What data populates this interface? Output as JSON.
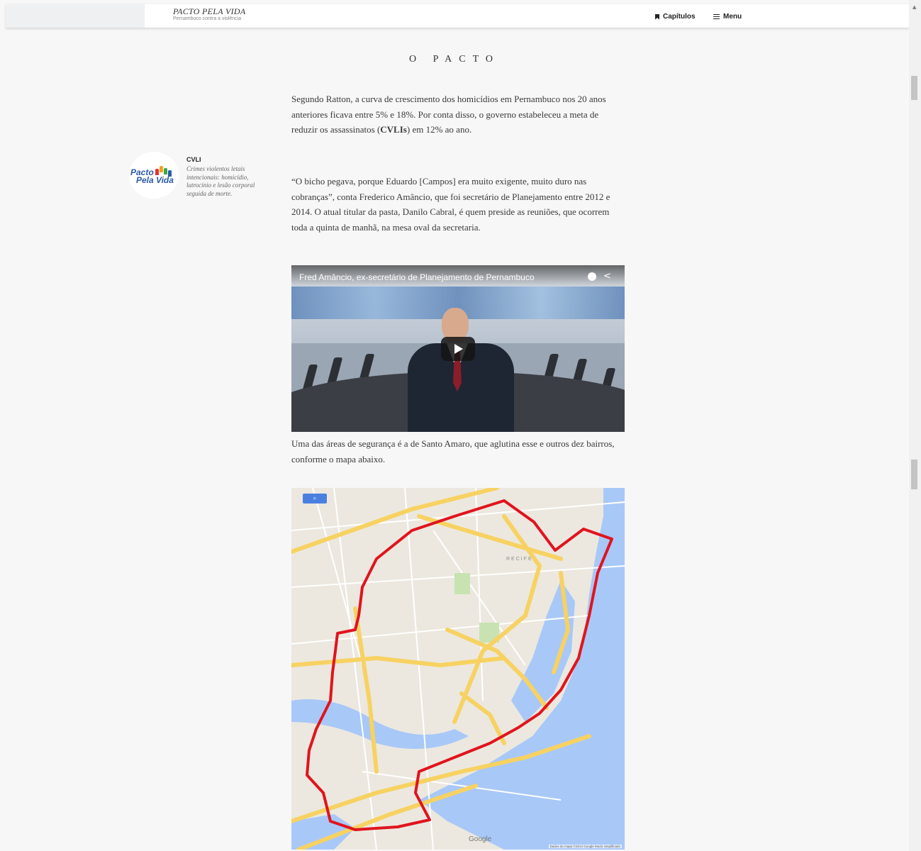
{
  "header": {
    "brand_title": "PACTO PELA VIDA",
    "brand_subtitle": "Pernambuco contra a violência",
    "nav_chapters": "Capítulos",
    "nav_menu": "Menu"
  },
  "article": {
    "section_title": "O PACTO",
    "p1_text": "Segundo Ratton, a curva de crescimento dos homicídios em Pernambuco nos 20 anos anteriores ficava entre 5% e 18%. Por conta disso, o governo estabeleceu a meta de reduzir os assassinatos (",
    "p1_bold": "CVLIs",
    "p1_tail": ") em 12% ao ano.",
    "p2_text": "“O bicho pegava, porque Eduardo [Campos] era muito exigente, muito duro nas cobranças”, conta Frederico Amâncio, que foi secretário de Planejamento entre 2012 e 2014. O atual titular da pasta, Danilo Cabral, é quem preside as reuniões, que ocorrem toda a quinta de manhã, na mesa oval da secretaria.",
    "p3_text": "Uma das áreas de segurança é a de Santo Amaro, que aglutina esse e outros dez bairros, conforme o mapa abaixo."
  },
  "sidenote": {
    "logo_line1": "Pacto",
    "logo_line2": "Pela Vida",
    "heading": "CVLI",
    "body": "Crimes violentos letais intencionais: homicídio, latrocínio e lesão corporal seguida de morte."
  },
  "video": {
    "title": "Fred Amâncio, ex-secretário de Planejamento de Pernambuco"
  },
  "map": {
    "area_label": "RECIFE",
    "brand": "Google",
    "footer": "Dados do mapa ©2014 Google    Modo simplificado"
  },
  "colors": {
    "area_outline": "#e0141e",
    "road": "#f7d263",
    "water": "#a8c8f8",
    "logo_blue": "#2b5aa6"
  }
}
